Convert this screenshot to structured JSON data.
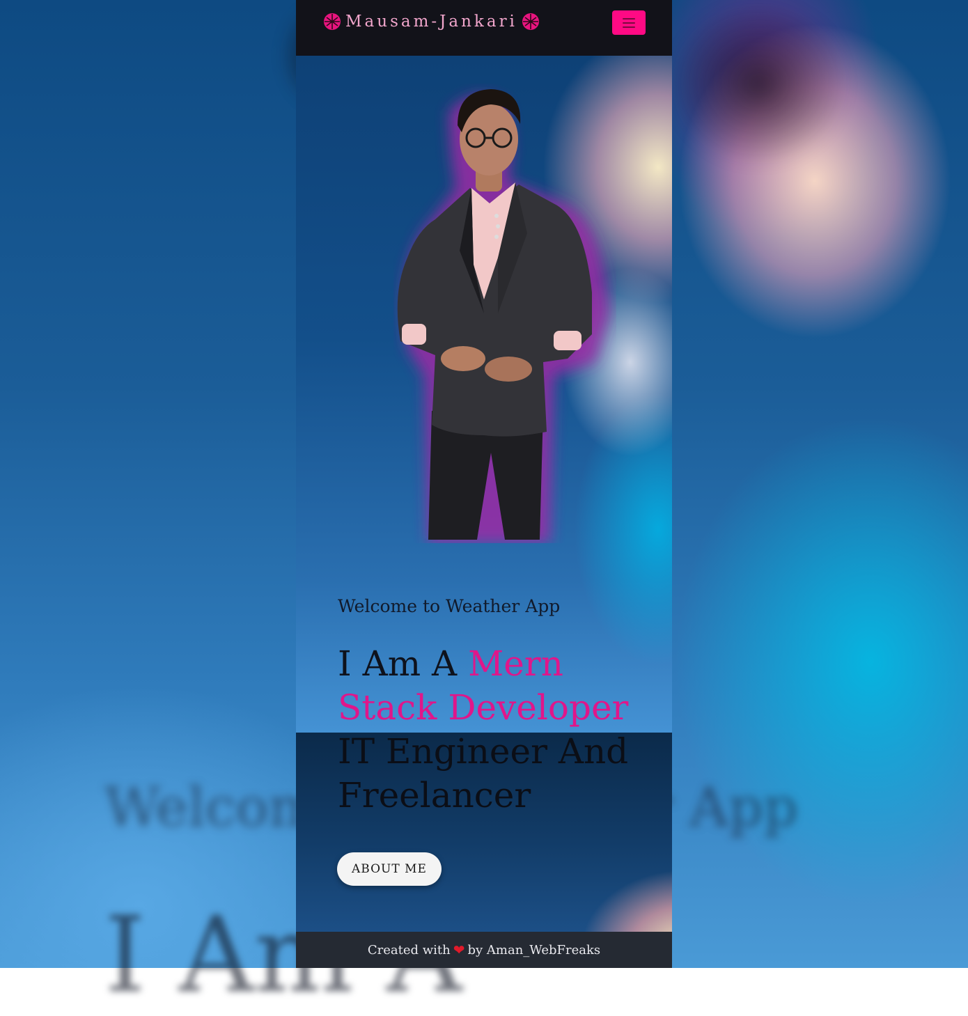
{
  "navbar": {
    "brand_text": "Mausam-Jankari",
    "brand_icon": "dribbble-icon",
    "menu_icon": "hamburger-menu-icon",
    "brand_color": "#e8147f",
    "menu_button_color": "#ff0a84"
  },
  "hero": {
    "welcome": "Welcome to Weather App",
    "headline_prefix": "I Am A ",
    "headline_accent": "Mern Stack Developer",
    "headline_comma": " ,",
    "headline_rest": "IT Engineer And Freelancer",
    "accent_color": "#e0168a",
    "portrait_icon": "developer-portrait-image",
    "about_button_label": "ABOUT ME"
  },
  "footer": {
    "prefix": "Created with",
    "heart_icon": "heart-icon",
    "heart_char": "❤",
    "suffix": "by Aman_WebFreaks"
  }
}
